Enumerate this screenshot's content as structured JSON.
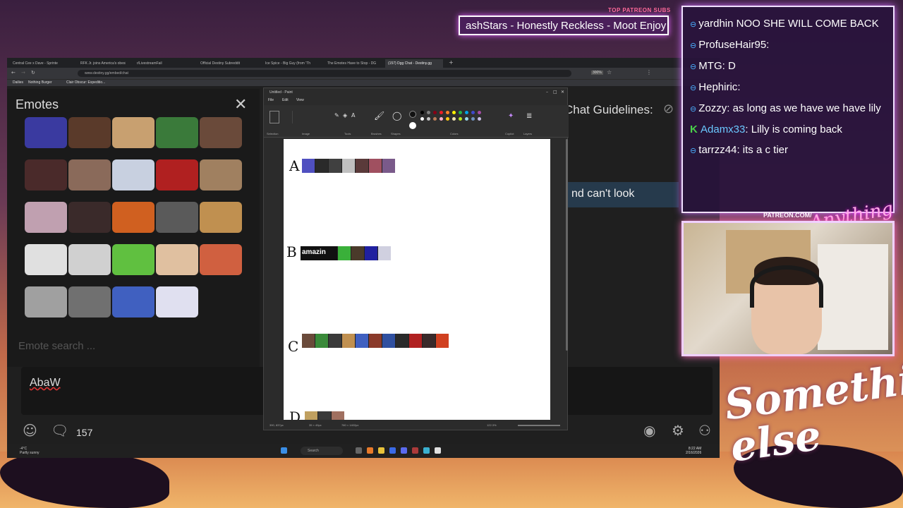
{
  "overlay": {
    "top_label": "TOP PATREON SUBS",
    "ticker_text": "ashStars - Honestly Reckless - Moot Enjoy",
    "patreon_label": "PATREON.COM/",
    "brand_script": "Anything else",
    "script_title": "Something else"
  },
  "browser": {
    "tabs": [
      {
        "label": "Central Cee x Dave - Sprinter (l"
      },
      {
        "label": "RFK Jr. joins America's obesity"
      },
      {
        "label": "r/LivestreamFail"
      },
      {
        "label": "Official Destiny Subreddit"
      },
      {
        "label": "Ice Spice - Big Guy (from 'The"
      },
      {
        "label": "The Emotes Have to Stop - DG"
      },
      {
        "label": "(157) Dgg Chat - Destiny.gg",
        "active": true
      }
    ],
    "url": "www.destiny.gg/embed/chat",
    "zoom": "300%",
    "bookmarks": [
      "Dailies",
      "Nothing Burger",
      "Clair Obscur: Expeditio..."
    ]
  },
  "emote_panel": {
    "title": "Emotes",
    "search_placeholder": "Emote search ...",
    "emote_colors": [
      "#3a3aa0",
      "#5a3a2a",
      "#c8a070",
      "#3a7a3a",
      "#6a4a3a",
      "#4a2a2a",
      "#8a6a5a",
      "#c8d0e0",
      "#b02020",
      "#a08060",
      "#c0a0b0",
      "#3a2a2a",
      "#d06020",
      "#5a5a5a",
      "#c09050",
      "#e0e0e0",
      "#d0d0d0",
      "#60c040",
      "#e0c0a0",
      "#d06040",
      "#a0a0a0",
      "#707070",
      "#4060c0",
      "#e0e0f0"
    ]
  },
  "chat": {
    "guidelines": "Chat Guidelines:",
    "visible_line": "nd can't look",
    "input_value": "AbaW",
    "user_count": "157"
  },
  "taskbar": {
    "weather": "-4°C",
    "weather_desc": "Partly sunny",
    "search_label": "Search",
    "time": "8:22 AM",
    "date": "2/16/2026"
  },
  "paint": {
    "title": "Untitled - Paint",
    "menu": [
      "File",
      "Edit",
      "View"
    ],
    "ribbon_groups": [
      "Selection",
      "Image",
      "Tools",
      "Brushes",
      "Shapes",
      "Colors",
      "Copilot",
      "Layers"
    ],
    "tiers": [
      {
        "letter": "A",
        "colors": [
          "#5050c0",
          "#2a2a2a",
          "#404040",
          "#c0c0c0",
          "#5a3a3a",
          "#a05060",
          "#7a5a8a"
        ]
      },
      {
        "letter": "B",
        "text": "amazin",
        "colors": [
          "#3ab03a",
          "#4a3a2a",
          "#2020a0",
          "#d0d0e0"
        ]
      },
      {
        "letter": "C",
        "colors": [
          "#6a4a3a",
          "#3a8a3a",
          "#3a3a3a",
          "#c09050",
          "#4060c0",
          "#8a3a2a",
          "#3050a0",
          "#2a2a2a",
          "#b02020",
          "#3a2a2a",
          "#d04020"
        ]
      },
      {
        "letter": "D",
        "colors": [
          "#c0a060",
          "#3a3a3a",
          "#a07060"
        ]
      }
    ],
    "status_pos": "390, 837px",
    "status_sel": "35 × 49px",
    "status_size": "780 × 1402px",
    "zoom": "122.3%"
  },
  "overlay_chat": {
    "messages": [
      {
        "user": "yardhin",
        "text": " NOO SHE WILL COME BACK"
      },
      {
        "user": "ProfuseHair95",
        "text": ":"
      },
      {
        "user": "MTG",
        "text": ": D"
      },
      {
        "user": "Hephiric",
        "text": ":"
      },
      {
        "user": "Zozzy",
        "text": ": as long as we have  we have lily"
      },
      {
        "user": "Adamx33",
        "text": ": Lilly is coming back",
        "mod": true
      },
      {
        "user": "tarrzz44",
        "text": ": its a c tier"
      }
    ]
  }
}
